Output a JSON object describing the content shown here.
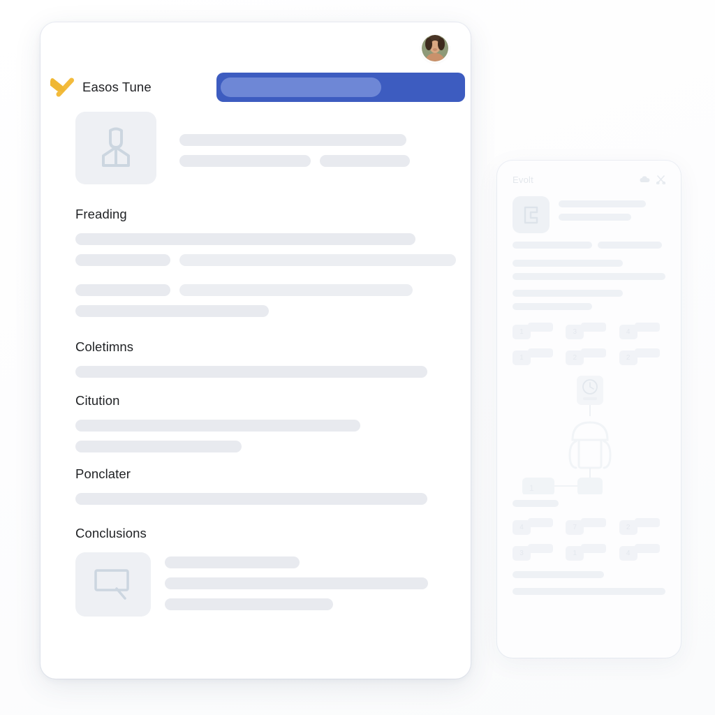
{
  "theme": {
    "brand_yellow": "#f3bb3c",
    "progress_blue": "#3d5cc0",
    "progress_fill_blue": "#6e87d6",
    "skeleton_gray": "#e8eaef",
    "tile_gray": "#eef0f4",
    "text_dark": "#1f2124",
    "card_white": "#ffffff"
  },
  "document_card": {
    "brand_name": "Easos Tune",
    "logo_icon": "yellow-chevron-logo",
    "avatar_icon": "user-photo-avatar",
    "progress": {
      "value_percent": 67,
      "icon": "progress-bar"
    },
    "profile": {
      "icon": "person-placeholder-icon",
      "lines": [
        [
          {
            "w": "78%"
          }
        ],
        [
          {
            "w": "45%"
          },
          {
            "w": "31%"
          }
        ]
      ]
    },
    "sections": [
      {
        "title": "Freading",
        "icon": null,
        "lines": [
          [
            {
              "w": "86%"
            }
          ],
          [
            {
              "w": "24%"
            },
            {
              "w": "70%"
            }
          ],
          [
            {
              "w": "24%"
            },
            {
              "w": "59%"
            }
          ],
          [
            {
              "w": "54%"
            }
          ]
        ]
      },
      {
        "title": "Coletimns",
        "icon": null,
        "lines": [
          [
            {
              "w": "97%"
            }
          ]
        ]
      },
      {
        "title": "Citution",
        "icon": null,
        "lines": [
          [
            {
              "w": "76%"
            }
          ],
          [
            {
              "w": "44%"
            }
          ]
        ]
      },
      {
        "title": "Ponclater",
        "icon": null,
        "lines": [
          [
            {
              "w": "97%"
            }
          ]
        ]
      },
      {
        "title": "Conclusions",
        "icon": "chat-bubble-icon",
        "lines": [
          [
            {
              "w": "44%"
            }
          ],
          [
            {
              "w": "86%"
            }
          ],
          [
            {
              "w": "55%"
            }
          ]
        ]
      }
    ]
  },
  "phone_card": {
    "title": "Evolt",
    "header_icons": [
      "cloud-icon",
      "scissors-icon"
    ],
    "top_block": {
      "icon": "bracket-frame-icon",
      "lines": [
        [
          {
            "w": "82%"
          }
        ],
        [
          {
            "w": "68%"
          }
        ]
      ]
    },
    "split_row": [
      {
        "w": "52%"
      },
      {
        "w": "42%"
      }
    ],
    "body_lines": [
      [
        {
          "w": "74%"
        }
      ],
      [
        {
          "w": "100%"
        }
      ],
      [
        {
          "w": "74%"
        }
      ],
      [
        {
          "w": "52%"
        }
      ]
    ],
    "chip_grid_top": [
      {
        "label": "1"
      },
      {
        "label": "3"
      },
      {
        "label": "4"
      },
      {
        "label": "1"
      },
      {
        "label": "2"
      },
      {
        "label": "2"
      }
    ],
    "diagram": {
      "node_icon": "clock-gauge-icon",
      "figure_icon": "person-figure-icon",
      "bottom_nodes": [
        "1",
        ""
      ]
    },
    "mid_bars": [
      [
        {
          "w": "34%"
        }
      ]
    ],
    "chip_grid_bottom": [
      {
        "label": "4"
      },
      {
        "label": "7"
      },
      {
        "label": "2"
      },
      {
        "label": "3"
      },
      {
        "label": "1"
      },
      {
        "label": "4"
      }
    ],
    "foot_lines": [
      [
        {
          "w": "64%"
        }
      ],
      [
        {
          "w": "100%"
        }
      ]
    ]
  }
}
